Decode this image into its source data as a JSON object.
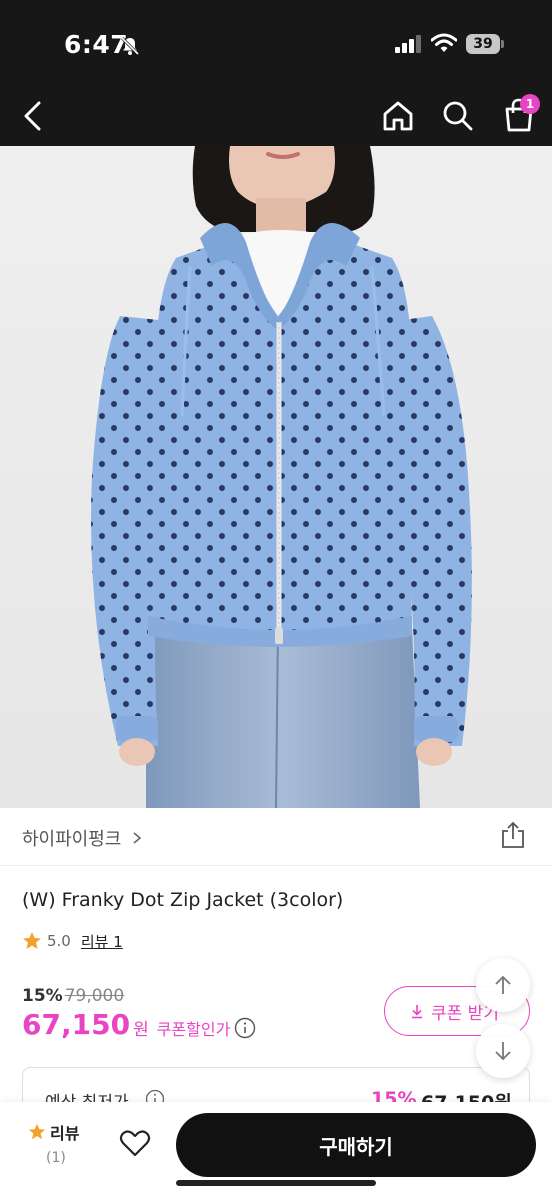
{
  "status_bar": {
    "time": "6:47",
    "battery_level": "39"
  },
  "nav": {
    "cart_count": "1"
  },
  "product": {
    "brand": "하이파이펑크",
    "title": "(W) Franky Dot Zip Jacket (3color)",
    "rating": "5.0",
    "review_label": "리뷰 1",
    "discount_rate": "15%",
    "original_price": "79,000",
    "sale_price": "67,150",
    "currency_unit": "원",
    "coupon_price_label": "쿠폰할인가",
    "coupon_button_label": "쿠폰 받기"
  },
  "price_box": {
    "label": "예상 최저가",
    "rate": "15%",
    "amount": "67,150원"
  },
  "bottom_bar": {
    "review_label": "리뷰",
    "review_count": "(1)",
    "buy_label": "구매하기"
  },
  "colors": {
    "accent": "#e844c4",
    "header_bg": "#171717",
    "jacket": "#8fb4e4",
    "dots": "#1f2a55",
    "denim": "#8ea6c6"
  }
}
